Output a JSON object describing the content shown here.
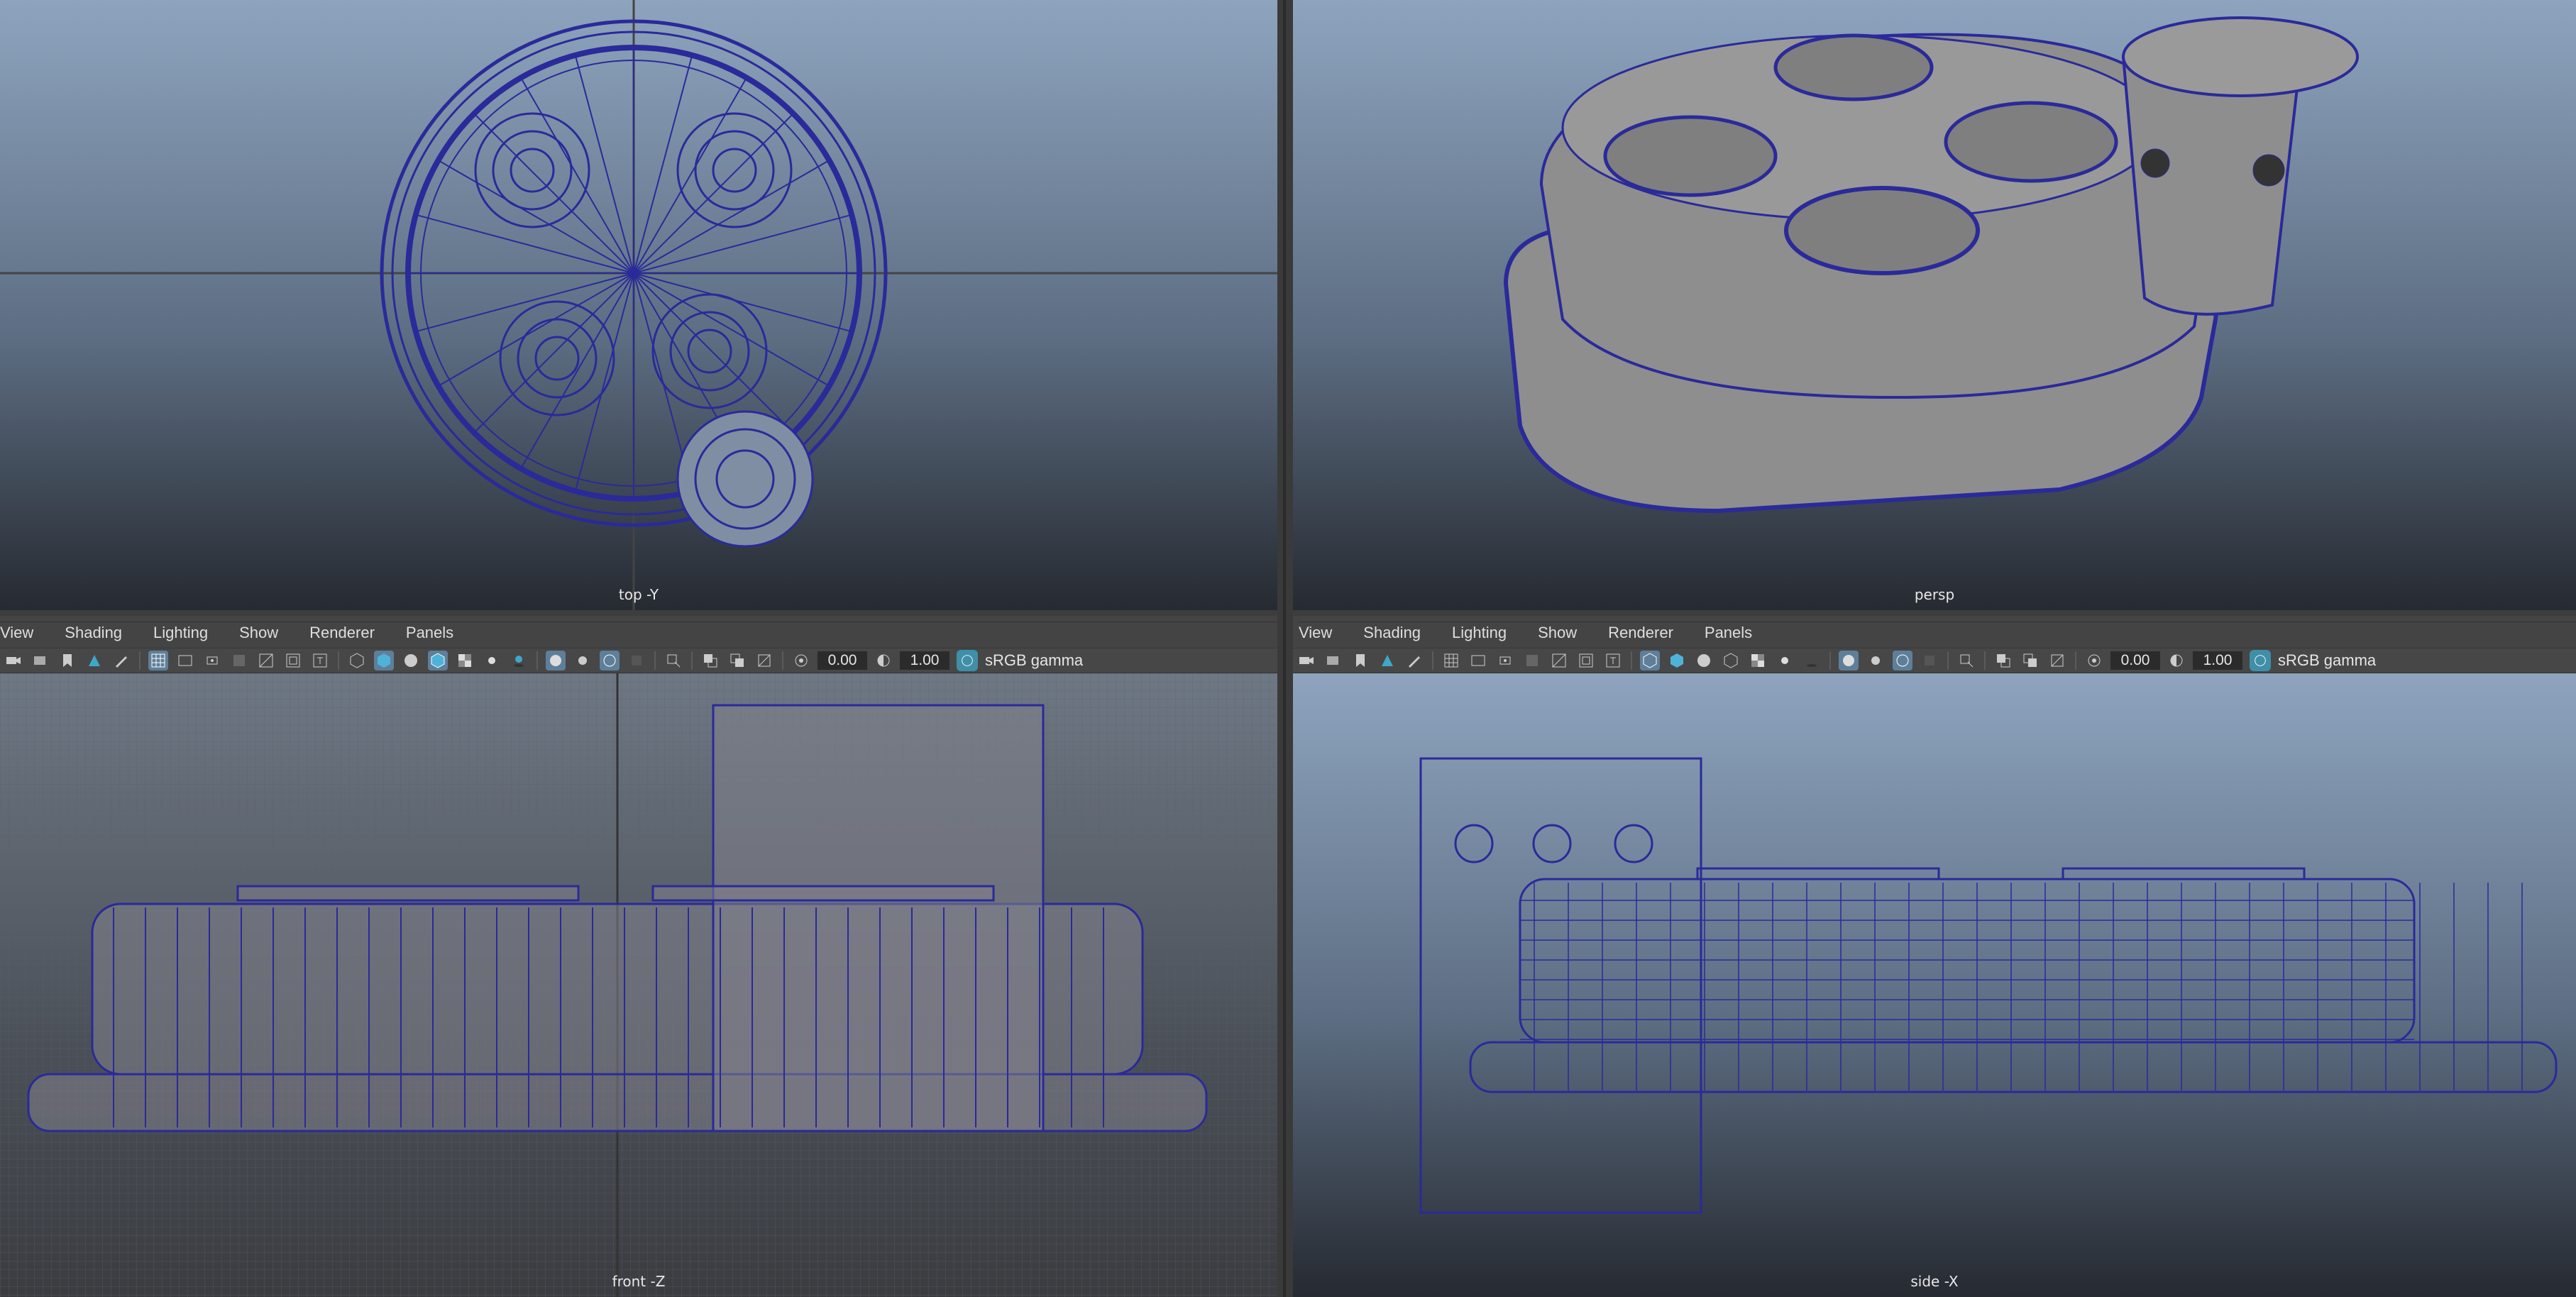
{
  "viewports": {
    "top_left": {
      "label": "top -Y"
    },
    "top_right": {
      "label": "persp"
    },
    "bottom_left": {
      "label": "front -Z"
    },
    "bottom_right": {
      "label": "side -X"
    }
  },
  "panel_menu": [
    "View",
    "Shading",
    "Lighting",
    "Show",
    "Renderer",
    "Panels"
  ],
  "toolbar": {
    "exposure": "0.00",
    "gamma": "1.00",
    "color_management": "sRGB gamma"
  },
  "colors": {
    "viewport_top": "#8ea4be",
    "viewport_bottom": "#2c3038",
    "wireframe": "#2a2a9a",
    "surface": "#8e8e8e"
  }
}
